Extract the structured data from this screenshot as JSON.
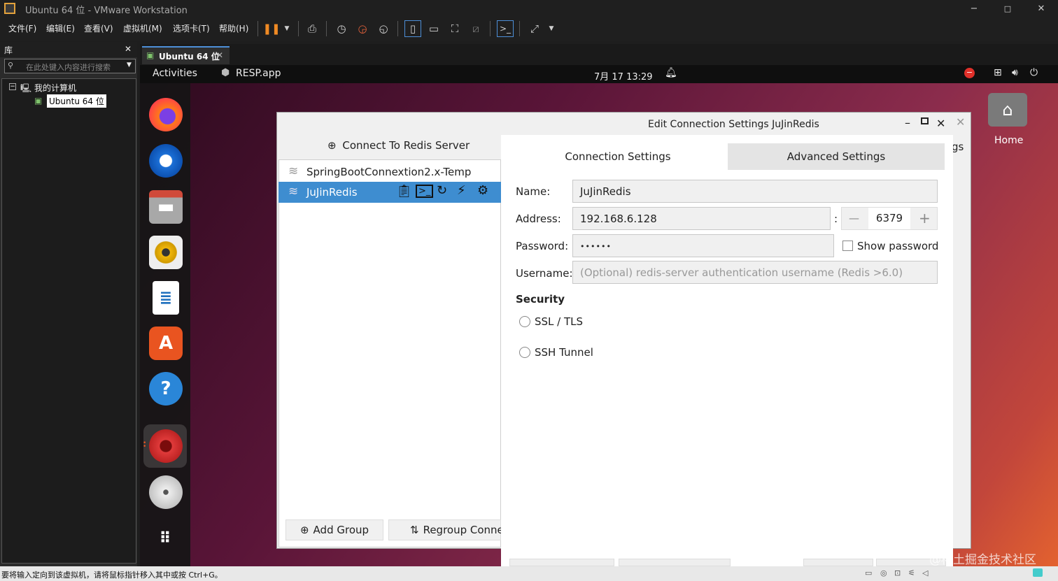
{
  "window": {
    "title": "Ubuntu 64 位 - VMware Workstation",
    "min": "−",
    "max": "□",
    "close": "✕"
  },
  "menu": [
    "文件(F)",
    "编辑(E)",
    "查看(V)",
    "虚拟机(M)",
    "选项卡(T)",
    "帮助(H)"
  ],
  "library": {
    "title": "库",
    "close": "✕",
    "search_placeholder": "在此处键入内容进行搜索",
    "tree_root": "我的计算机",
    "tree_child": "Ubuntu 64 位"
  },
  "vm_tab": {
    "label": "Ubuntu 64 位",
    "close": "✕"
  },
  "ubuntu": {
    "activities": "Activities",
    "app": "RESP.app",
    "datetime": "7月 17  13:29",
    "home_label": "Home"
  },
  "dialog": {
    "title": "Edit Connection Settings JuJinRedis",
    "connect_button": "Connect To Redis Server",
    "connections": [
      "SpringBootConnextion2.x-Temp",
      "JuJinRedis"
    ],
    "add_group": "Add Group",
    "regroup": "Regroup Conne",
    "behind_tab_fragment": "gs",
    "tabs": {
      "connection": "Connection Settings",
      "advanced": "Advanced Settings"
    },
    "form": {
      "name_label": "Name:",
      "name_value": "JuJinRedis",
      "address_label": "Address:",
      "address_value": "192.168.6.128",
      "colon": ":",
      "port_value": "6379",
      "port_minus": "—",
      "port_plus": "+",
      "password_label": "Password:",
      "password_value": "••••••",
      "show_password": "Show password",
      "username_label": "Username:",
      "username_placeholder": "(Optional) redis-server authentication username (Redis >6.0)"
    },
    "security": {
      "heading": "Security",
      "ssl": "SSL / TLS",
      "ssh": "SSH Tunnel"
    }
  },
  "statusbar": {
    "text": "要将输入定向到该虚拟机，请将鼠标指针移入其中或按 Ctrl+G。"
  },
  "watermark": "@稀土掘金技术社区",
  "colors": {
    "selection": "#3e8dd0",
    "accent": "#4d8fd8",
    "ubuntu_orange": "#e95420"
  }
}
